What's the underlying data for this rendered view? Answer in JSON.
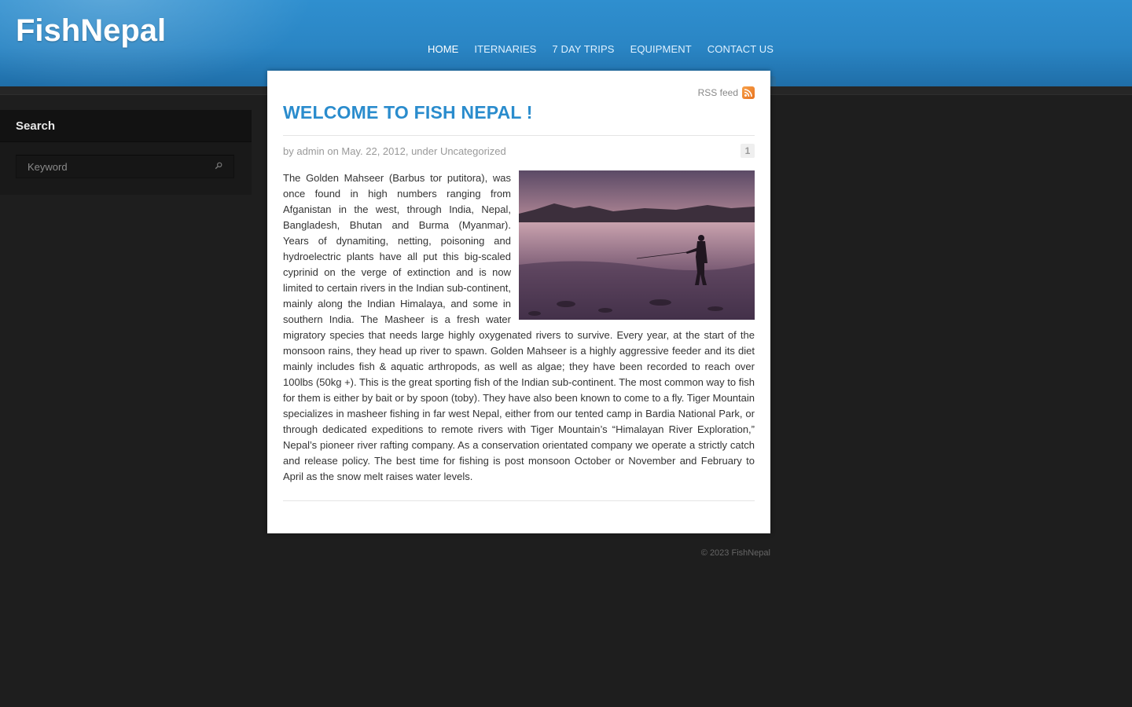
{
  "site": {
    "title": "FishNepal"
  },
  "nav": {
    "items": [
      {
        "label": "HOME"
      },
      {
        "label": "ITERNARIES"
      },
      {
        "label": "7 DAY TRIPS"
      },
      {
        "label": "EQUIPMENT"
      },
      {
        "label": "CONTACT US"
      }
    ],
    "active_index": 0
  },
  "sidebar": {
    "search_title": "Search",
    "search_placeholder": "Keyword"
  },
  "post": {
    "rss_label": "RSS feed",
    "title": "WELCOME TO FISH NEPAL !",
    "meta": "by admin on May. 22, 2012, under Uncategorized",
    "comment_count": "1",
    "body": "The Golden Mahseer (Barbus tor putitora), was once found in high numbers ranging from Afganistan in the west, through India, Nepal, Bangladesh, Bhutan and Burma (Myanmar). Years of dynamiting, netting, poisoning and hydroelectric plants have all put this big-scaled cyprinid on the verge of extinction and is now limited to certain rivers in the Indian sub-continent, mainly along the Indian Himalaya, and some in southern India. The Masheer is a fresh water migratory species that needs large highly oxygenated rivers to survive. Every year, at the start of the monsoon rains, they head up river to spawn. Golden Mahseer is a highly aggressive feeder and its diet mainly includes fish & aquatic arthropods, as well as algae; they have been recorded to reach over 100lbs (50kg +). This is the great sporting fish of the Indian sub-continent. The most common way to fish for them is either by bait or by spoon (toby). They have also been known to come to a fly. Tiger Mountain specializes in masheer fishing in far west Nepal, either from our tented camp in Bardia National Park, or through dedicated expeditions to remote rivers with Tiger Mountain’s “Himalayan River Exploration,” Nepal’s pioneer river rafting company. As a conservation orientated company we operate a strictly catch and release policy. The best time for fishing is post monsoon October or November and February to April as the snow melt raises water levels."
  },
  "footer": {
    "copyright": "© 2023 FishNepal"
  },
  "colors": {
    "accent": "#2a8ccd",
    "header": "#2a85c4",
    "background": "#1e1e1e"
  },
  "icons": {
    "rss": "rss-icon",
    "search": "search-icon"
  }
}
